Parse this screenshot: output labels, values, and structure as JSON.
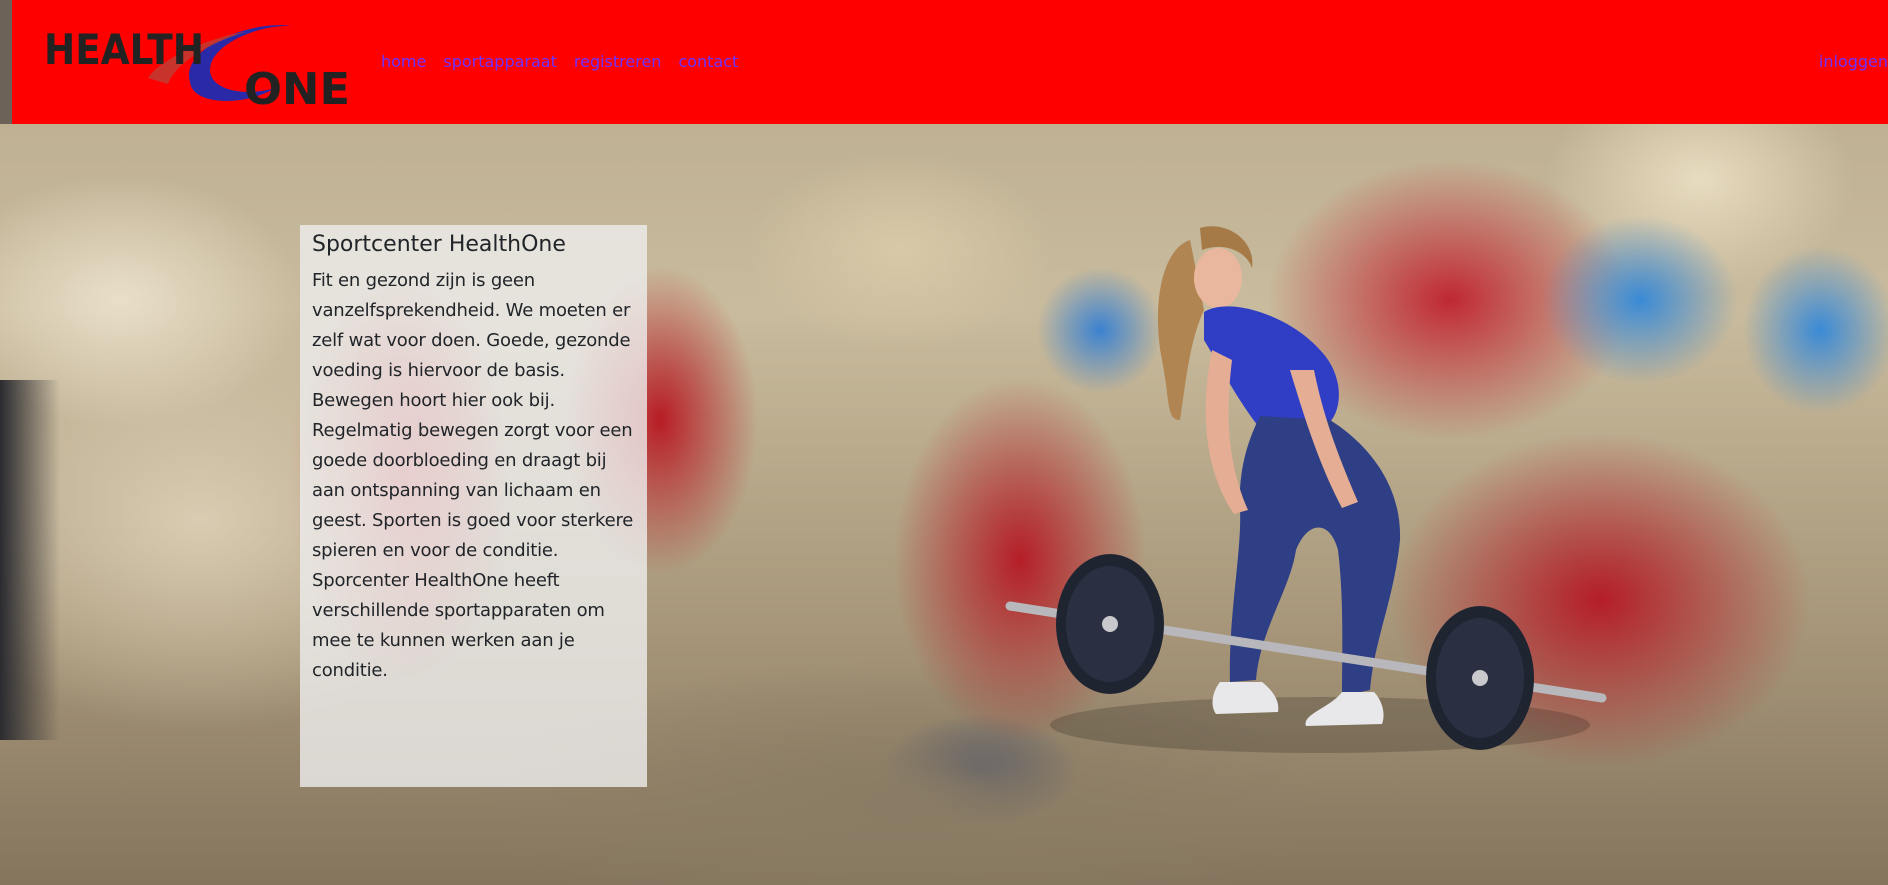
{
  "brand": {
    "logo_word_top": "HEALTH",
    "logo_word_bottom": "ONE",
    "colors": {
      "header_red": "#ff0000",
      "link_purple": "#6e33ff",
      "logo_blue": "#2a2aa8",
      "logo_dark": "#222222"
    }
  },
  "nav": {
    "items": [
      {
        "label": "home"
      },
      {
        "label": "sportapparaat"
      },
      {
        "label": "registreren"
      },
      {
        "label": "contact"
      }
    ],
    "login_label": "inloggen"
  },
  "intro": {
    "title": "Sportcenter HealthOne",
    "body": "Fit en gezond zijn is geen vanzelfsprekendheid. We moeten er zelf wat voor doen. Goede, gezonde voeding is hiervoor de basis. Bewegen hoort hier ook bij. Regelmatig bewegen zorgt voor een goede doorbloeding en draagt bij aan ontspanning van lichaam en geest. Sporten is goed voor sterkere spieren en voor de conditie. Sporcenter HealthOne heeft verschillende sportapparaten om mee te kunnen werken aan je conditie."
  },
  "hero": {
    "background_icon": "gym-background-photo",
    "figure_icon": "woman-with-barbell-photo"
  }
}
